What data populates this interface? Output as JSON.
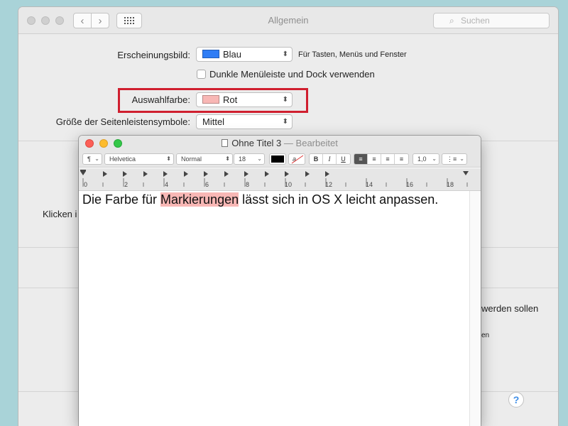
{
  "prefs": {
    "title": "Allgemein",
    "search_placeholder": "Suchen",
    "appearance": {
      "label": "Erscheinungsbild:",
      "value": "Blau",
      "swatch_color": "#2f7df5",
      "hint": "Für Tasten, Menüs und Fenster"
    },
    "dark_menu": {
      "label": "Dunkle Menüleiste und Dock verwenden",
      "checked": false
    },
    "highlight": {
      "label": "Auswahlfarbe:",
      "value": "Rot",
      "swatch_color": "#f8b7b5"
    },
    "sidebar_size": {
      "label": "Größe der Seitenleistensymbole:",
      "value": "Mittel"
    },
    "partial_left": "Klicken i",
    "partial_right_1": "werden sollen",
    "partial_right_2": "en",
    "help_label": "?"
  },
  "textedit": {
    "filename": "Ohne Titel 3",
    "dash": "—",
    "status": "Bearbeitet",
    "toolbar": {
      "paragraph": "¶",
      "font": "Helvetica",
      "style": "Normal",
      "size": "18",
      "bold": "B",
      "italic": "I",
      "underline": "U",
      "line_spacing": "1,0"
    },
    "ruler_numbers": [
      "0",
      "2",
      "4",
      "6",
      "8",
      "10",
      "12",
      "14",
      "16",
      "18"
    ],
    "doc_before": "Die Farbe für ",
    "doc_selected": "Markierungen",
    "doc_after": " lässt sich in OS X leicht anpassen."
  }
}
